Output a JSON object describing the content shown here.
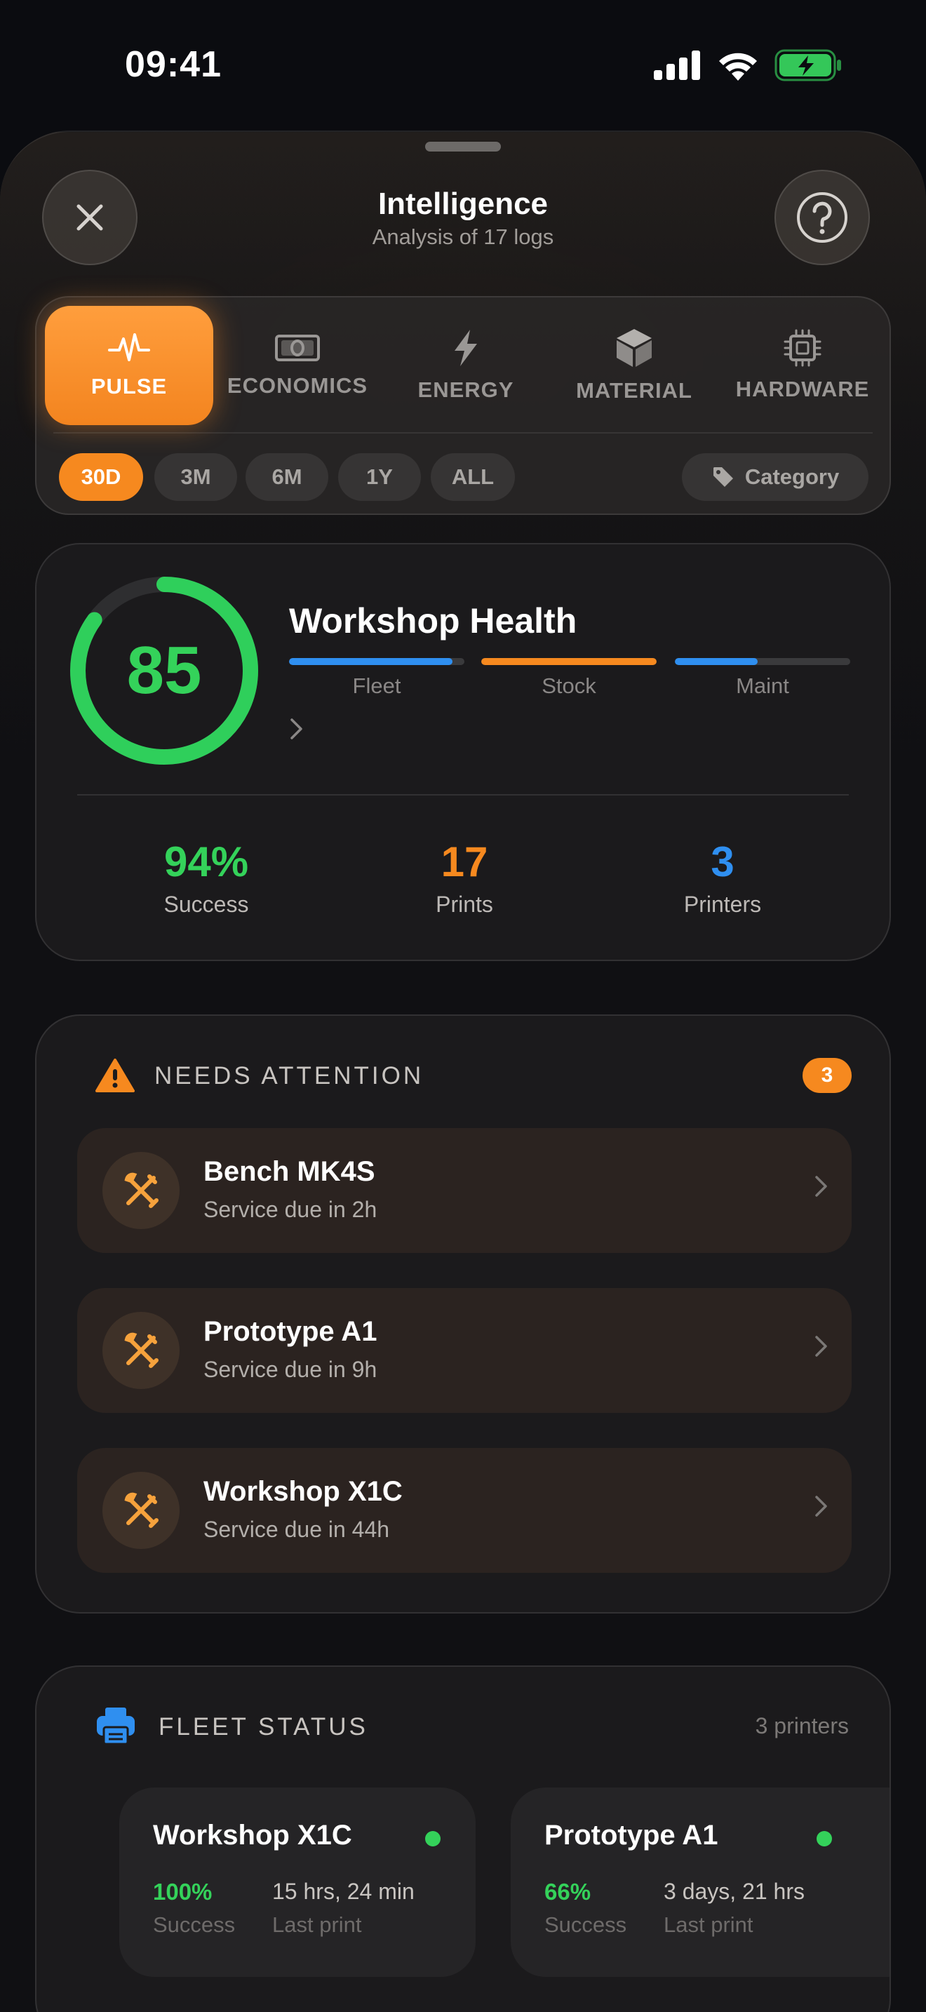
{
  "status_bar": {
    "time": "09:41"
  },
  "header": {
    "title": "Intelligence",
    "subtitle": "Analysis of 17 logs"
  },
  "tabs": [
    {
      "label": "PULSE",
      "icon": "pulse-icon",
      "active": true
    },
    {
      "label": "ECONOMICS",
      "icon": "money-icon"
    },
    {
      "label": "ENERGY",
      "icon": "bolt-icon"
    },
    {
      "label": "MATERIAL",
      "icon": "cube-icon"
    },
    {
      "label": "HARDWARE",
      "icon": "chip-icon"
    }
  ],
  "ranges": [
    "30D",
    "3M",
    "6M",
    "1Y",
    "ALL"
  ],
  "selected_range": "30D",
  "category_label": "Category",
  "health": {
    "score": "85",
    "score_value": 85,
    "title": "Workshop Health",
    "bars": [
      {
        "label": "Fleet",
        "value": 0.93,
        "color": "#2f8ff0"
      },
      {
        "label": "Stock",
        "value": 1.0,
        "color": "#f6891f"
      },
      {
        "label": "Maint",
        "value": 0.47,
        "color": "#2f8ff0"
      }
    ],
    "stats": [
      {
        "value": "94%",
        "label": "Success",
        "color": "#34d25a"
      },
      {
        "value": "17",
        "label": "Prints",
        "color": "#f6891f"
      },
      {
        "value": "3",
        "label": "Printers",
        "color": "#2f8ff0"
      }
    ]
  },
  "attention": {
    "title": "NEEDS ATTENTION",
    "count": "3",
    "items": [
      {
        "name": "Bench MK4S",
        "detail": "Service due in 2h"
      },
      {
        "name": "Prototype A1",
        "detail": "Service due in 9h"
      },
      {
        "name": "Workshop X1C",
        "detail": "Service due in 44h"
      }
    ]
  },
  "fleet": {
    "title": "FLEET STATUS",
    "count_label": "3 printers",
    "printers": [
      {
        "name": "Workshop X1C",
        "success": "100%",
        "success_label": "Success",
        "last_print": "15 hrs, 24 min",
        "last_label": "Last print"
      },
      {
        "name": "Prototype A1",
        "success": "66%",
        "success_label": "Success",
        "last_print": "3 days, 21 hrs",
        "last_label": "Last print"
      }
    ]
  },
  "colors": {
    "accent": "#f6891f",
    "green": "#34d25a",
    "blue": "#2f8ff0"
  }
}
